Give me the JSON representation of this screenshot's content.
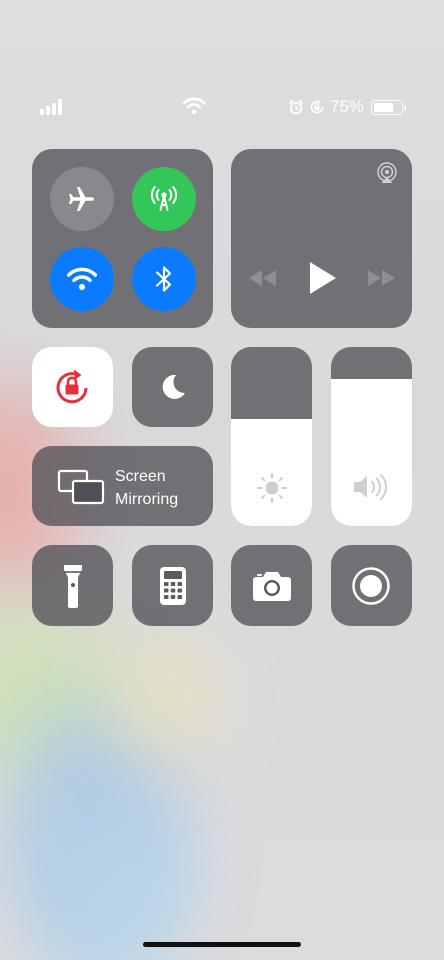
{
  "status_bar": {
    "battery_percent_text": "75%",
    "battery_level": 0.75,
    "signal_bars": 4,
    "icons": [
      "cellular-signal-icon",
      "wifi-icon",
      "alarm-icon",
      "orientation-lock-icon",
      "battery-icon"
    ]
  },
  "connectivity": {
    "airplane_mode": false,
    "cellular_data": true,
    "wifi": true,
    "bluetooth": true,
    "colors": {
      "active_green": "#33c759",
      "active_blue": "#0a7bff",
      "inactive": "#8c8c92"
    }
  },
  "screen_mirroring": {
    "line1": "Screen",
    "line2": "Mirroring"
  },
  "sliders": {
    "brightness_level": 0.6,
    "volume_level": 0.82
  },
  "orientation_lock": {
    "active": true,
    "color": "#e5303a"
  },
  "accent": {
    "tile_bg": "#525258",
    "tile_active": "#ffffff"
  }
}
